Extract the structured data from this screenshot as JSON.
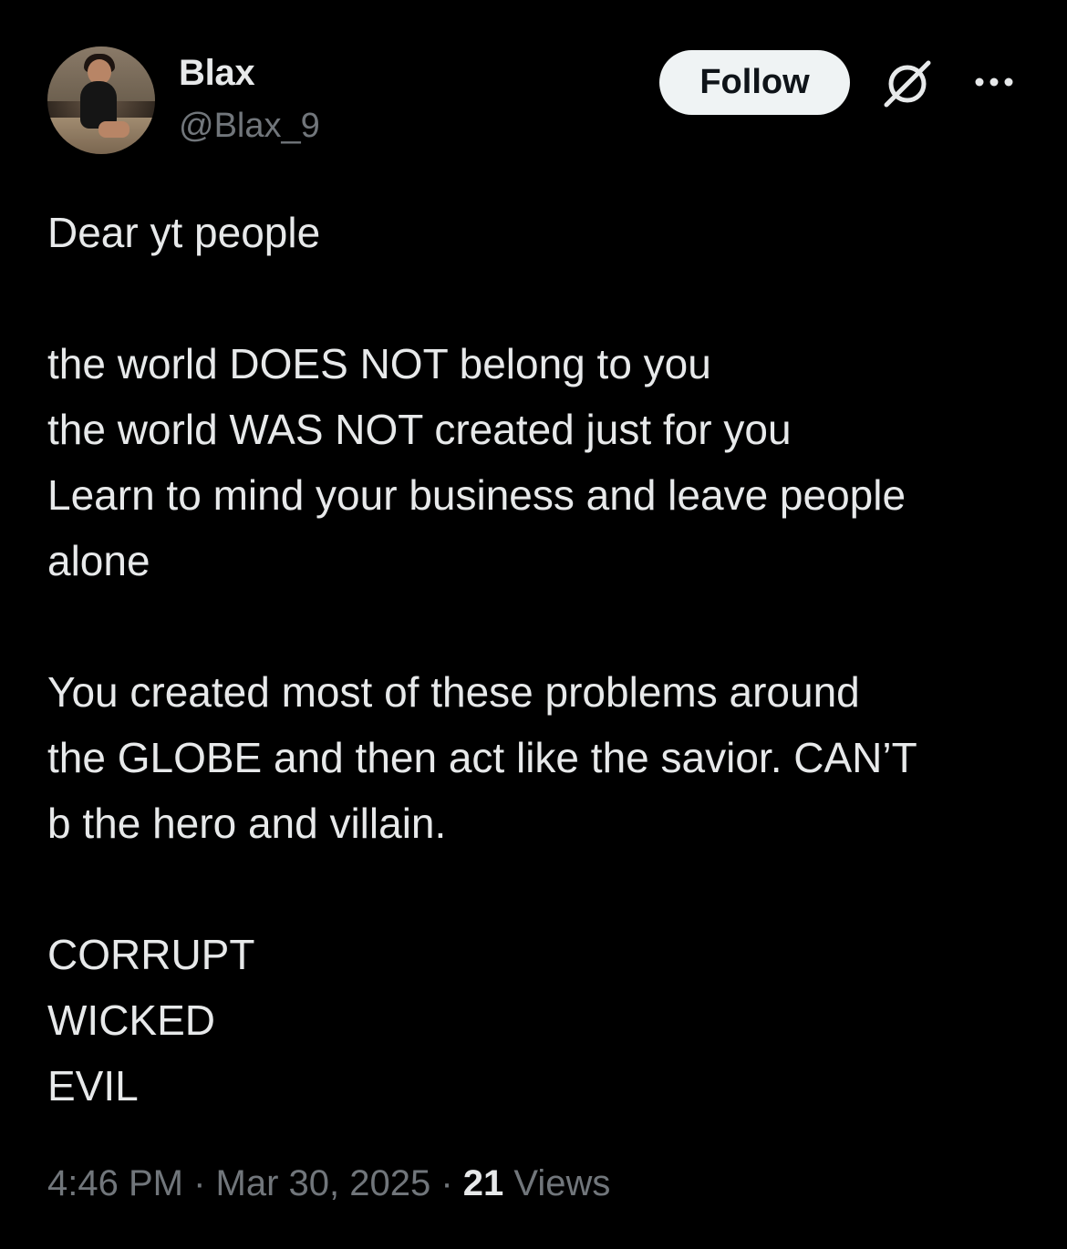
{
  "author": {
    "display_name": "Blax",
    "handle": "@Blax_9"
  },
  "actions": {
    "follow_label": "Follow",
    "grok_icon": "grok-icon",
    "more_icon": "more-icon"
  },
  "post": {
    "lines": [
      "Dear yt people",
      "",
      "the world DOES NOT belong to you",
      "the world WAS NOT created just for you",
      "Learn to mind your business and leave people",
      "alone",
      "",
      "You created most of these problems around",
      "the GLOBE and then act like the savior. CAN’T",
      "b the hero and villain.",
      "",
      "CORRUPT",
      "WICKED",
      "EVIL"
    ]
  },
  "meta": {
    "time": "4:46 PM",
    "separator_1": " · ",
    "date": "Mar 30, 2025",
    "separator_2": " · ",
    "views_count": "21",
    "views_label": " Views"
  },
  "colors": {
    "background": "#000000",
    "text_primary": "#e7e9ea",
    "text_secondary": "#71767b",
    "button_bg": "#eff3f4",
    "button_text": "#0f1419"
  }
}
